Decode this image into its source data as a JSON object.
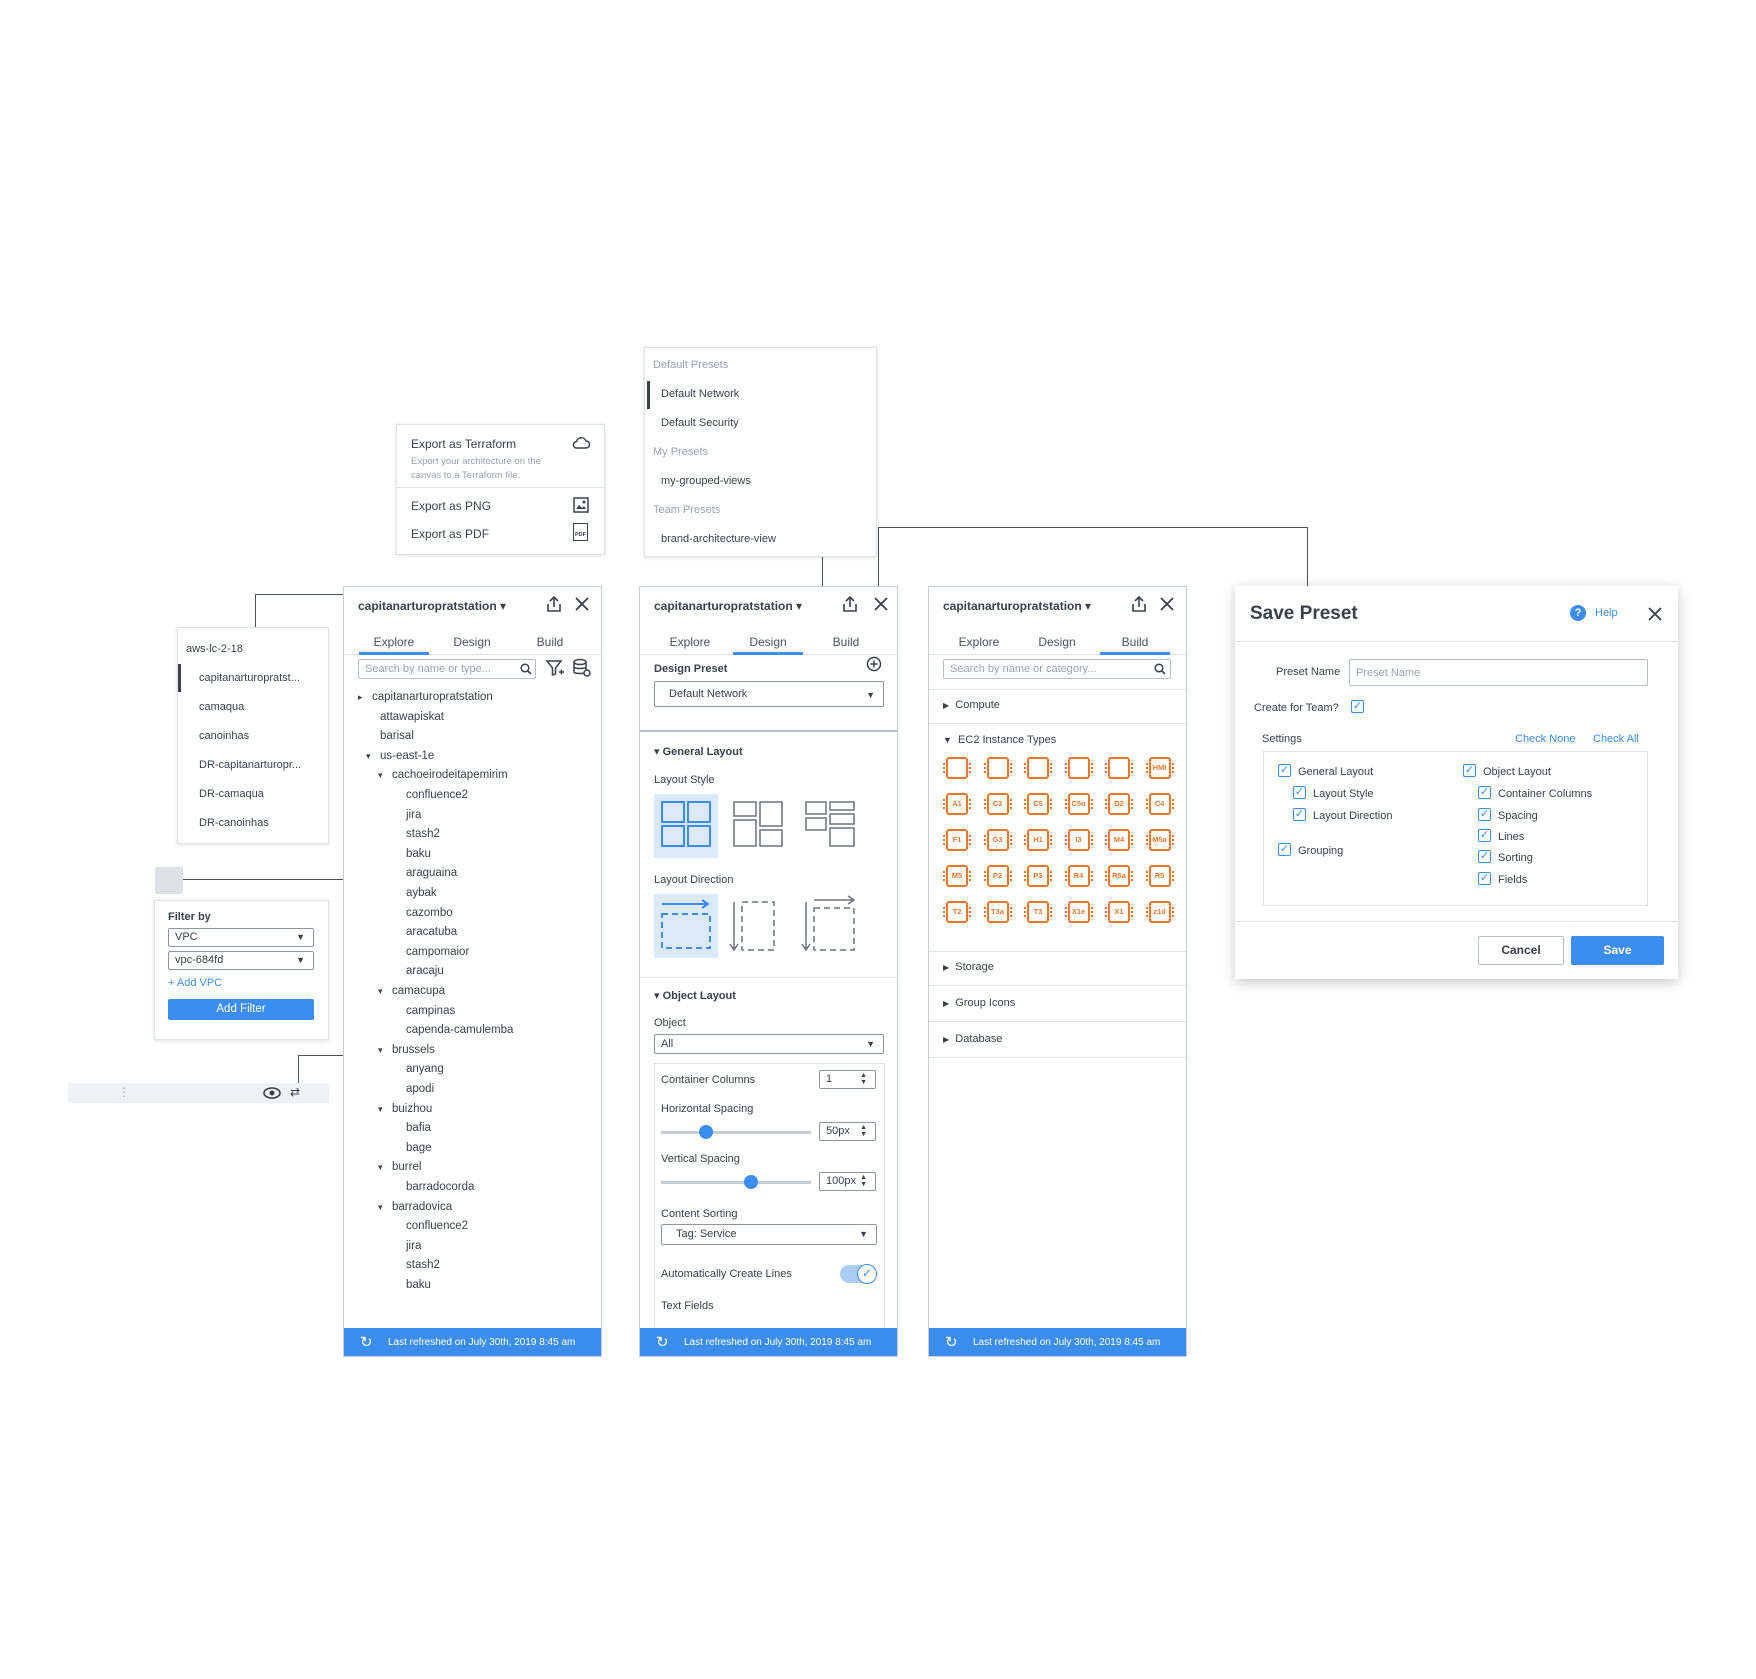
{
  "export_menu": {
    "terraform_title": "Export as Terraform",
    "terraform_desc_1": "Export your architecture on the",
    "terraform_desc_2": "canvas to a Terraform file.",
    "png": "Export as PNG",
    "pdf": "Export as PDF",
    "pdf_icon_text": "PDF"
  },
  "presets_menu": {
    "default_header": "Default Presets",
    "default_network": "Default Network",
    "default_security": "Default Security",
    "my_header": "My Presets",
    "my_grouped": "my-grouped-views",
    "team_header": "Team Presets",
    "brand_arch": "brand-architecture-view"
  },
  "account_list": {
    "header": "aws-lc-2-18",
    "items": [
      "capitanarturopratst...",
      "camaqua",
      "canoinhas",
      "DR-capitanarturopr...",
      "DR-camaqua",
      "DR-canoinhas"
    ]
  },
  "filter": {
    "title": "Filter by",
    "type_value": "VPC",
    "vpc_value": "vpc-684fd",
    "add_vpc": "+ Add VPC",
    "add_filter": "Add Filter"
  },
  "common": {
    "account": "capitanarturopratstation",
    "tab_explore": "Explore",
    "tab_design": "Design",
    "tab_build": "Build",
    "footer": "Last refreshed on July 30th, 2019    8:45 am"
  },
  "explore": {
    "search_placeholder": "Search by name or type...",
    "tree": [
      {
        "label": "capitanarturopratstation",
        "indent": 0,
        "arrow": "▸"
      },
      {
        "label": "attawapiskat",
        "indent": 1,
        "arrow": ""
      },
      {
        "label": "barisal",
        "indent": 1,
        "arrow": ""
      },
      {
        "label": "us-east-1e",
        "indent": 1,
        "arrow": "▾"
      },
      {
        "label": "cachoeirodeitapemirim",
        "indent": 2,
        "arrow": "▾"
      },
      {
        "label": "confluence2",
        "indent": 3,
        "arrow": ""
      },
      {
        "label": "jira",
        "indent": 3,
        "arrow": ""
      },
      {
        "label": "stash2",
        "indent": 3,
        "arrow": ""
      },
      {
        "label": "baku",
        "indent": 3,
        "arrow": ""
      },
      {
        "label": "araguaina",
        "indent": 3,
        "arrow": ""
      },
      {
        "label": "aybak",
        "indent": 3,
        "arrow": ""
      },
      {
        "label": "cazombo",
        "indent": 3,
        "arrow": ""
      },
      {
        "label": "aracatuba",
        "indent": 3,
        "arrow": ""
      },
      {
        "label": "campomaior",
        "indent": 3,
        "arrow": ""
      },
      {
        "label": "aracaju",
        "indent": 3,
        "arrow": ""
      },
      {
        "label": "camacupa",
        "indent": 2,
        "arrow": "▾"
      },
      {
        "label": "campinas",
        "indent": 3,
        "arrow": ""
      },
      {
        "label": "capenda-camulemba",
        "indent": 3,
        "arrow": ""
      },
      {
        "label": "brussels",
        "indent": 2,
        "arrow": "▾"
      },
      {
        "label": "anyang",
        "indent": 3,
        "arrow": ""
      },
      {
        "label": "apodi",
        "indent": 3,
        "arrow": ""
      },
      {
        "label": "buizhou",
        "indent": 2,
        "arrow": "▾"
      },
      {
        "label": "bafia",
        "indent": 3,
        "arrow": ""
      },
      {
        "label": "bage",
        "indent": 3,
        "arrow": ""
      },
      {
        "label": "burrel",
        "indent": 2,
        "arrow": "▾"
      },
      {
        "label": "barradocorda",
        "indent": 3,
        "arrow": ""
      },
      {
        "label": "barradovica",
        "indent": 2,
        "arrow": "▾"
      },
      {
        "label": "confluence2",
        "indent": 3,
        "arrow": ""
      },
      {
        "label": "jira",
        "indent": 3,
        "arrow": ""
      },
      {
        "label": "stash2",
        "indent": 3,
        "arrow": ""
      },
      {
        "label": "baku",
        "indent": 3,
        "arrow": ""
      }
    ]
  },
  "design": {
    "preset_label": "Design Preset",
    "preset_value": "Default Network",
    "general_layout": "General Layout",
    "layout_style": "Layout Style",
    "layout_direction": "Layout Direction",
    "object_layout": "Object Layout",
    "object_label": "Object",
    "object_value": "All",
    "container_columns": "Container Columns",
    "container_columns_value": "1",
    "horizontal_spacing": "Horizontal Spacing",
    "horizontal_spacing_value": "50px",
    "horizontal_spacing_level": 0.3,
    "vertical_spacing": "Vertical Spacing",
    "vertical_spacing_value": "100px",
    "vertical_spacing_level": 0.6,
    "content_sorting": "Content Sorting",
    "content_sorting_value": "Tag: Service",
    "auto_lines": "Automatically Create Lines",
    "text_fields": "Text Fields"
  },
  "build": {
    "search_placeholder": "Search by name or category...",
    "compute": "Compute",
    "ec2": "EC2 Instance Types",
    "chips": [
      "",
      "",
      "",
      "",
      "",
      "HMI",
      "A1",
      "C3",
      "C5",
      "C5n",
      "D2",
      "C4",
      "F1",
      "G3",
      "H1",
      "I3",
      "M4",
      "M5a",
      "M5",
      "P2",
      "P3",
      "R4",
      "R5a",
      "R5",
      "T2",
      "T3a",
      "T3",
      "X1e",
      "X1",
      "z1d"
    ],
    "storage": "Storage",
    "group_icons": "Group Icons",
    "database": "Database"
  },
  "save_preset": {
    "title": "Save Preset",
    "help": "Help",
    "name_label": "Preset Name",
    "name_placeholder": "Preset Name",
    "team_label": "Create for Team?",
    "settings": "Settings",
    "check_none": "Check None",
    "check_all": "Check All",
    "general_layout": "General Layout",
    "layout_style": "Layout Style",
    "layout_direction": "Layout Direction",
    "grouping": "Grouping",
    "object_layout": "Object Layout",
    "container_columns": "Container Columns",
    "spacing": "Spacing",
    "lines": "Lines",
    "sorting": "Sorting",
    "fields": "Fields",
    "cancel": "Cancel",
    "save": "Save"
  },
  "colors": {
    "accent": "#3b8df0",
    "ec2_orange": "#e8782c",
    "border": "#c9ced4"
  }
}
